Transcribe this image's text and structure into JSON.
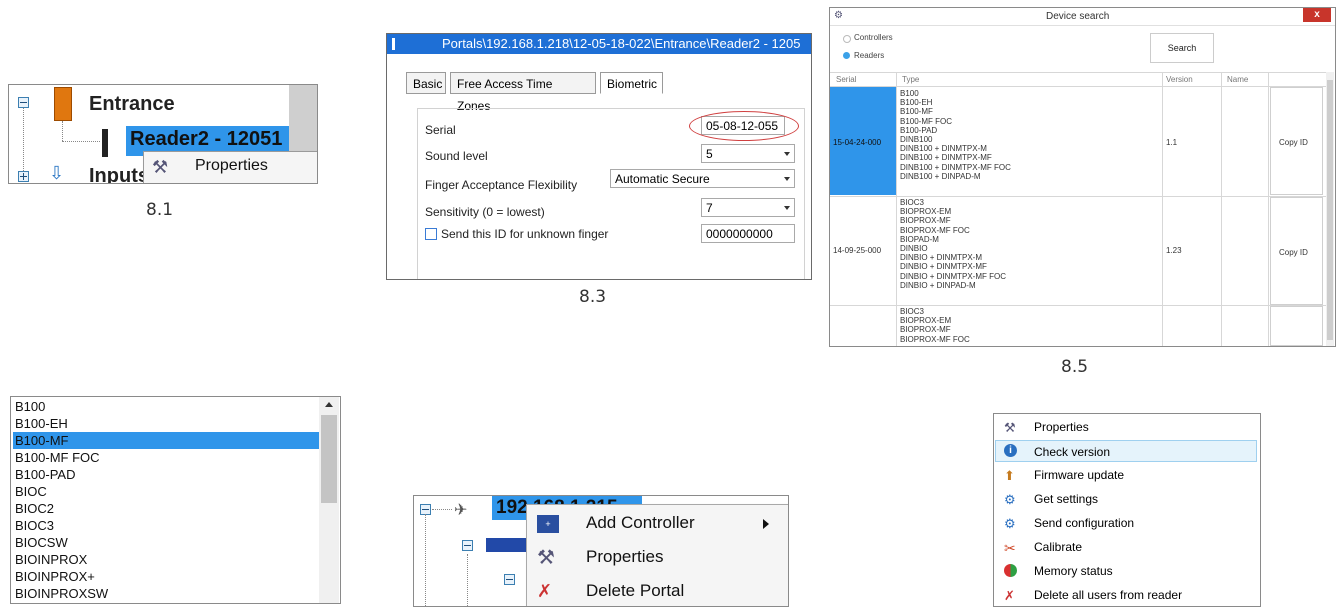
{
  "captions": {
    "c81": "8.1",
    "c83": "8.3",
    "c85": "8.5"
  },
  "tree81": {
    "entrance": "Entrance",
    "reader": "Reader2 - 12051",
    "inputs": "Inputs",
    "menu_properties": "Properties"
  },
  "dialog83": {
    "title": "Portals\\192.168.1.218\\12-05-18-022\\Entrance\\Reader2 - 1205",
    "tabs": [
      "Basic",
      "Free Access Time Zones",
      "Biometric"
    ],
    "serial_label": "Serial",
    "serial_value": "05-08-12-055",
    "sound_label": "Sound level",
    "sound_value": "5",
    "finger_label": "Finger Acceptance Flexibility",
    "finger_value": "Automatic Secure",
    "sens_label": "Sensitivity (0 = lowest)",
    "sens_value": "7",
    "unknown_label": "Send this ID for unknown finger",
    "unknown_value": "0000000000"
  },
  "device_search": {
    "title": "Device search",
    "close": "x",
    "radio_controllers": "Controllers",
    "radio_readers": "Readers",
    "search_button": "Search",
    "columns": [
      "Serial",
      "Type",
      "Version",
      "Name"
    ],
    "rows": [
      {
        "serial": "15-04-24-000",
        "types": [
          "B100",
          "B100-EH",
          "B100-MF",
          "B100-MF FOC",
          "B100-PAD",
          "DINB100",
          "DINB100 + DINMTPX-M",
          "DINB100 + DINMTPX-MF",
          "DINB100 + DINMTPX-MF FOC",
          "DINB100 + DINPAD-M"
        ],
        "version": "1.1",
        "action": "Copy ID"
      },
      {
        "serial": "14-09-25-000",
        "types": [
          "BIOC3",
          "BIOPROX-EM",
          "BIOPROX-MF",
          "BIOPROX-MF FOC",
          "BIOPAD-M",
          "DINBIO",
          "DINBIO + DINMTPX-M",
          "DINBIO + DINMTPX-MF",
          "DINBIO + DINMTPX-MF FOC",
          "DINBIO + DINPAD-M"
        ],
        "version": "1.23",
        "action": "Copy ID"
      },
      {
        "serial": "",
        "types": [
          "BIOC3",
          "BIOPROX-EM",
          "BIOPROX-MF",
          "BIOPROX-MF FOC"
        ],
        "version": "",
        "action": ""
      }
    ]
  },
  "type_list": [
    "B100",
    "B100-EH",
    "B100-MF",
    "B100-MF FOC",
    "B100-PAD",
    "BIOC",
    "BIOC2",
    "BIOC3",
    "BIOCSW",
    "BIOINPROX",
    "BIOINPROX+",
    "BIOINPROXSW"
  ],
  "portal_menu": {
    "node": "192.168.1.215",
    "items": [
      "Add Controller",
      "Properties",
      "Delete Portal"
    ]
  },
  "reader_menu": [
    "Properties",
    "Check version",
    "Firmware update",
    "Get settings",
    "Send configuration",
    "Calibrate",
    "Memory status",
    "Delete all users from reader"
  ],
  "colors": {
    "selection": "#2f95ea",
    "titlebar": "#1e6fd6",
    "hover": "#e5f3fb"
  }
}
